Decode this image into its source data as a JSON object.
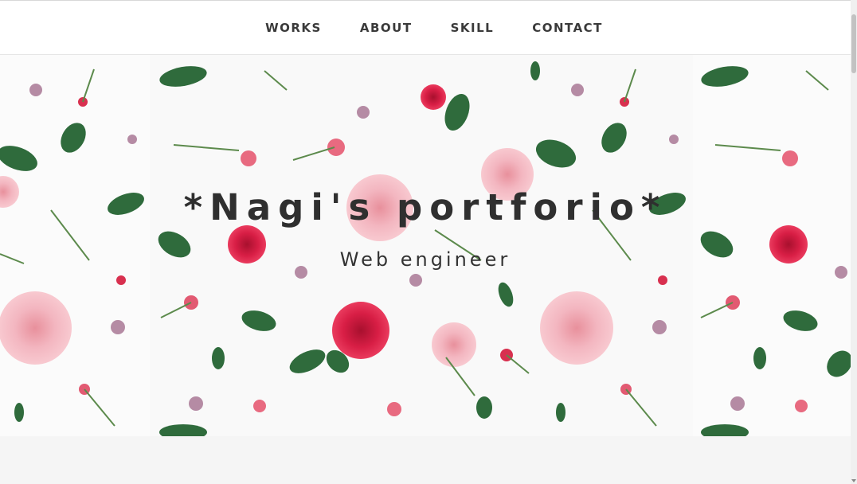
{
  "nav": {
    "items": [
      {
        "label": "WORKS"
      },
      {
        "label": "ABOUT"
      },
      {
        "label": "SKILL"
      },
      {
        "label": "CONTACT"
      }
    ]
  },
  "hero": {
    "title": "*Nagi's portforio*",
    "subtitle": "Web engineer",
    "background": "floral-pattern-roses"
  },
  "colors": {
    "nav_background": "#ffffff",
    "nav_text": "#3a3a3a",
    "hero_text": "#2f2f2f",
    "page_background": "#f5f5f5"
  }
}
